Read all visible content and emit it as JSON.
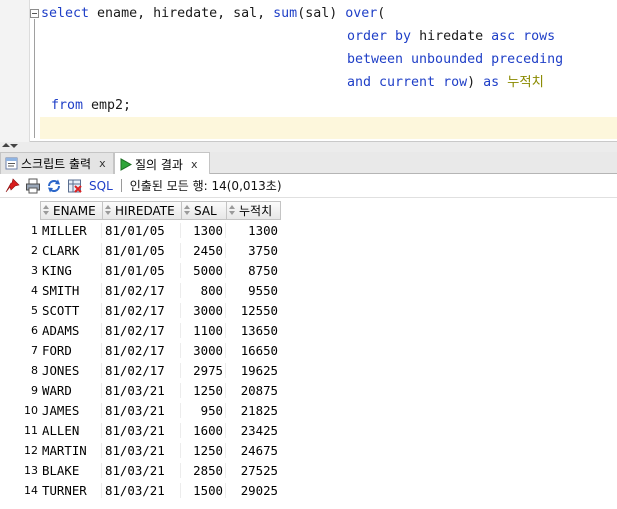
{
  "editor": {
    "lines": [
      [
        {
          "t": "select ",
          "k": "kw"
        },
        {
          "t": "ename, hiredate, sal, ",
          "k": "id"
        },
        {
          "t": "sum",
          "k": "kw"
        },
        {
          "t": "(sal) ",
          "k": "id"
        },
        {
          "t": "over",
          "k": "kw"
        },
        {
          "t": "(",
          "k": "id"
        }
      ],
      [
        {
          "t": "order by ",
          "k": "kw"
        },
        {
          "t": "hiredate ",
          "k": "id"
        },
        {
          "t": "asc rows",
          "k": "kw"
        }
      ],
      [
        {
          "t": "between unbounded preceding",
          "k": "kw"
        }
      ],
      [
        {
          "t": "and current row",
          "k": "kw"
        },
        {
          "t": ") ",
          "k": "id"
        },
        {
          "t": "as ",
          "k": "kw"
        },
        {
          "t": "누적치",
          "k": "ko"
        }
      ],
      [
        {
          "t": "from ",
          "k": "kw"
        },
        {
          "t": "emp2;",
          "k": "id"
        }
      ]
    ]
  },
  "tabs": [
    {
      "label": "스크립트 출력",
      "close": "x",
      "active": false
    },
    {
      "label": "질의 결과",
      "close": "x",
      "active": true
    }
  ],
  "toolbar": {
    "sql_label": "SQL",
    "status": "인출된 모든 행: 14(0,013초)"
  },
  "grid": {
    "columns": [
      "ENAME",
      "HIREDATE",
      "SAL",
      "누적치"
    ],
    "rows": [
      {
        "n": "1",
        "ename": "MILLER",
        "hiredate": "81/01/05",
        "sal": "1300",
        "cum": "1300"
      },
      {
        "n": "2",
        "ename": "CLARK",
        "hiredate": "81/01/05",
        "sal": "2450",
        "cum": "3750"
      },
      {
        "n": "3",
        "ename": "KING",
        "hiredate": "81/01/05",
        "sal": "5000",
        "cum": "8750"
      },
      {
        "n": "4",
        "ename": "SMITH",
        "hiredate": "81/02/17",
        "sal": "800",
        "cum": "9550"
      },
      {
        "n": "5",
        "ename": "SCOTT",
        "hiredate": "81/02/17",
        "sal": "3000",
        "cum": "12550"
      },
      {
        "n": "6",
        "ename": "ADAMS",
        "hiredate": "81/02/17",
        "sal": "1100",
        "cum": "13650"
      },
      {
        "n": "7",
        "ename": "FORD",
        "hiredate": "81/02/17",
        "sal": "3000",
        "cum": "16650"
      },
      {
        "n": "8",
        "ename": "JONES",
        "hiredate": "81/02/17",
        "sal": "2975",
        "cum": "19625"
      },
      {
        "n": "9",
        "ename": "WARD",
        "hiredate": "81/03/21",
        "sal": "1250",
        "cum": "20875"
      },
      {
        "n": "10",
        "ename": "JAMES",
        "hiredate": "81/03/21",
        "sal": "950",
        "cum": "21825"
      },
      {
        "n": "11",
        "ename": "ALLEN",
        "hiredate": "81/03/21",
        "sal": "1600",
        "cum": "23425"
      },
      {
        "n": "12",
        "ename": "MARTIN",
        "hiredate": "81/03/21",
        "sal": "1250",
        "cum": "24675"
      },
      {
        "n": "13",
        "ename": "BLAKE",
        "hiredate": "81/03/21",
        "sal": "2850",
        "cum": "27525"
      },
      {
        "n": "14",
        "ename": "TURNER",
        "hiredate": "81/03/21",
        "sal": "1500",
        "cum": "29025"
      }
    ]
  },
  "icons": [
    "pin-icon",
    "print-icon",
    "refresh-icon",
    "export-icon",
    "run-icon",
    "script-icon"
  ],
  "colors": {
    "keyword": "#1f3fc7",
    "korean_alias": "#8a8a00",
    "current_line": "#fdf7dc"
  }
}
